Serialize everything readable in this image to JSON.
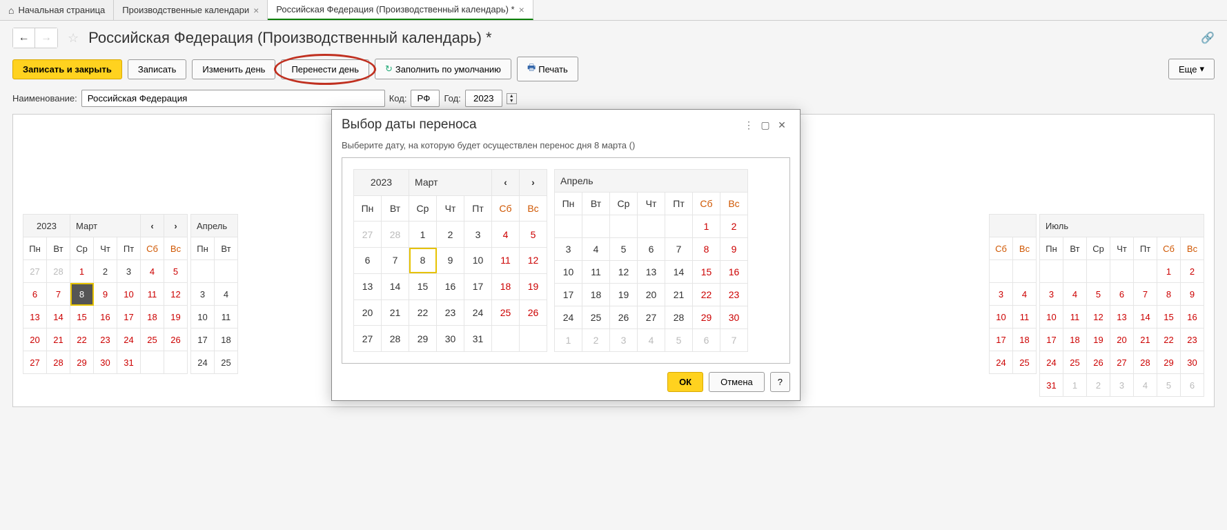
{
  "tabs": {
    "home": "Начальная страница",
    "cal_list": "Производственные календари",
    "current": "Российская Федерация (Производственный календарь) *"
  },
  "page_title": "Российская Федерация (Производственный календарь) *",
  "toolbar": {
    "save_close": "Записать и закрыть",
    "save": "Записать",
    "change_day": "Изменить день",
    "move_day": "Перенести день",
    "fill_default": "Заполнить по умолчанию",
    "print": "Печать",
    "more": "Еще"
  },
  "form": {
    "name_label": "Наименование:",
    "name_value": "Российская Федерация",
    "code_label": "Код:",
    "code_value": "РФ",
    "year_label": "Год:",
    "year_value": "2023"
  },
  "dialog": {
    "title": "Выбор даты переноса",
    "subtitle": "Выберите дату, на которую будет осуществлен перенос дня 8 марта ()",
    "ok": "ОК",
    "cancel": "Отмена",
    "help": "?"
  },
  "dow": [
    "Пн",
    "Вт",
    "Ср",
    "Чт",
    "Пт",
    "Сб",
    "Вс"
  ],
  "bg_months": {
    "year": "2023",
    "march": "Март",
    "april": "Апрель",
    "july": "Июль"
  },
  "dlg_months": {
    "year": "2023",
    "march": "Март",
    "april": "Апрель"
  },
  "bg_march": [
    [
      {
        "d": "27",
        "c": "other"
      },
      {
        "d": "28",
        "c": "other"
      },
      {
        "d": "1",
        "c": "wk"
      },
      {
        "d": "2",
        "c": ""
      },
      {
        "d": "3",
        "c": ""
      },
      {
        "d": "4",
        "c": "wk"
      },
      {
        "d": "5",
        "c": "wk"
      }
    ],
    [
      {
        "d": "6",
        "c": "wk"
      },
      {
        "d": "7",
        "c": "wk"
      },
      {
        "d": "8",
        "c": "sel"
      },
      {
        "d": "9",
        "c": "wk"
      },
      {
        "d": "10",
        "c": "wk"
      },
      {
        "d": "11",
        "c": "wk"
      },
      {
        "d": "12",
        "c": "wk"
      }
    ],
    [
      {
        "d": "13",
        "c": "wk"
      },
      {
        "d": "14",
        "c": "wk"
      },
      {
        "d": "15",
        "c": "wk"
      },
      {
        "d": "16",
        "c": "wk"
      },
      {
        "d": "17",
        "c": "wk"
      },
      {
        "d": "18",
        "c": "wk"
      },
      {
        "d": "19",
        "c": "wk"
      }
    ],
    [
      {
        "d": "20",
        "c": "wk"
      },
      {
        "d": "21",
        "c": "wk"
      },
      {
        "d": "22",
        "c": "wk"
      },
      {
        "d": "23",
        "c": "wk"
      },
      {
        "d": "24",
        "c": "wk"
      },
      {
        "d": "25",
        "c": "wk"
      },
      {
        "d": "26",
        "c": "wk"
      }
    ],
    [
      {
        "d": "27",
        "c": "wk"
      },
      {
        "d": "28",
        "c": "wk"
      },
      {
        "d": "29",
        "c": "wk"
      },
      {
        "d": "30",
        "c": "wk"
      },
      {
        "d": "31",
        "c": "wk"
      },
      {
        "d": "",
        "c": ""
      },
      {
        "d": "",
        "c": ""
      }
    ]
  ],
  "bg_april_partial": [
    [
      {
        "d": "",
        "c": ""
      },
      {
        "d": "",
        "c": ""
      }
    ],
    [
      {
        "d": "3",
        "c": ""
      },
      {
        "d": "4",
        "c": ""
      }
    ],
    [
      {
        "d": "10",
        "c": ""
      },
      {
        "d": "11",
        "c": ""
      }
    ],
    [
      {
        "d": "17",
        "c": ""
      },
      {
        "d": "18",
        "c": ""
      }
    ],
    [
      {
        "d": "24",
        "c": ""
      },
      {
        "d": "25",
        "c": ""
      }
    ]
  ],
  "bg_right_sbvs": [
    [
      {
        "d": "",
        "c": ""
      },
      {
        "d": "",
        "c": ""
      }
    ],
    [
      {
        "d": "3",
        "c": "wk"
      },
      {
        "d": "4",
        "c": "wk"
      }
    ],
    [
      {
        "d": "10",
        "c": "wk"
      },
      {
        "d": "11",
        "c": "wk"
      }
    ],
    [
      {
        "d": "17",
        "c": "wk"
      },
      {
        "d": "18",
        "c": "wk"
      }
    ],
    [
      {
        "d": "24",
        "c": "wk"
      },
      {
        "d": "25",
        "c": "wk"
      }
    ]
  ],
  "bg_july": [
    [
      {
        "d": "",
        "c": ""
      },
      {
        "d": "",
        "c": ""
      },
      {
        "d": "",
        "c": ""
      },
      {
        "d": "",
        "c": ""
      },
      {
        "d": "",
        "c": ""
      },
      {
        "d": "1",
        "c": "wk"
      },
      {
        "d": "2",
        "c": "wk"
      }
    ],
    [
      {
        "d": "3",
        "c": "wk"
      },
      {
        "d": "4",
        "c": "wk"
      },
      {
        "d": "5",
        "c": "wk"
      },
      {
        "d": "6",
        "c": "wk"
      },
      {
        "d": "7",
        "c": "wk"
      },
      {
        "d": "8",
        "c": "wk"
      },
      {
        "d": "9",
        "c": "wk"
      }
    ],
    [
      {
        "d": "10",
        "c": "wk"
      },
      {
        "d": "11",
        "c": "wk"
      },
      {
        "d": "12",
        "c": "wk"
      },
      {
        "d": "13",
        "c": "wk"
      },
      {
        "d": "14",
        "c": "wk"
      },
      {
        "d": "15",
        "c": "wk"
      },
      {
        "d": "16",
        "c": "wk"
      }
    ],
    [
      {
        "d": "17",
        "c": "wk"
      },
      {
        "d": "18",
        "c": "wk"
      },
      {
        "d": "19",
        "c": "wk"
      },
      {
        "d": "20",
        "c": "wk"
      },
      {
        "d": "21",
        "c": "wk"
      },
      {
        "d": "22",
        "c": "wk"
      },
      {
        "d": "23",
        "c": "wk"
      }
    ],
    [
      {
        "d": "24",
        "c": "wk"
      },
      {
        "d": "25",
        "c": "wk"
      },
      {
        "d": "26",
        "c": "wk"
      },
      {
        "d": "27",
        "c": "wk"
      },
      {
        "d": "28",
        "c": "wk"
      },
      {
        "d": "29",
        "c": "wk"
      },
      {
        "d": "30",
        "c": "wk"
      }
    ],
    [
      {
        "d": "31",
        "c": "wk"
      },
      {
        "d": "1",
        "c": "other"
      },
      {
        "d": "2",
        "c": "other"
      },
      {
        "d": "3",
        "c": "other"
      },
      {
        "d": "4",
        "c": "other"
      },
      {
        "d": "5",
        "c": "other"
      },
      {
        "d": "6",
        "c": "other"
      }
    ]
  ],
  "dlg_march": [
    [
      {
        "d": "27",
        "c": "other"
      },
      {
        "d": "28",
        "c": "other"
      },
      {
        "d": "1",
        "c": ""
      },
      {
        "d": "2",
        "c": ""
      },
      {
        "d": "3",
        "c": ""
      },
      {
        "d": "4",
        "c": "wk"
      },
      {
        "d": "5",
        "c": "wk"
      }
    ],
    [
      {
        "d": "6",
        "c": ""
      },
      {
        "d": "7",
        "c": ""
      },
      {
        "d": "8",
        "c": "hl"
      },
      {
        "d": "9",
        "c": ""
      },
      {
        "d": "10",
        "c": ""
      },
      {
        "d": "11",
        "c": "wk"
      },
      {
        "d": "12",
        "c": "wk"
      }
    ],
    [
      {
        "d": "13",
        "c": ""
      },
      {
        "d": "14",
        "c": ""
      },
      {
        "d": "15",
        "c": ""
      },
      {
        "d": "16",
        "c": ""
      },
      {
        "d": "17",
        "c": ""
      },
      {
        "d": "18",
        "c": "wk"
      },
      {
        "d": "19",
        "c": "wk"
      }
    ],
    [
      {
        "d": "20",
        "c": ""
      },
      {
        "d": "21",
        "c": ""
      },
      {
        "d": "22",
        "c": ""
      },
      {
        "d": "23",
        "c": ""
      },
      {
        "d": "24",
        "c": ""
      },
      {
        "d": "25",
        "c": "wk"
      },
      {
        "d": "26",
        "c": "wk"
      }
    ],
    [
      {
        "d": "27",
        "c": ""
      },
      {
        "d": "28",
        "c": ""
      },
      {
        "d": "29",
        "c": ""
      },
      {
        "d": "30",
        "c": ""
      },
      {
        "d": "31",
        "c": ""
      },
      {
        "d": "",
        "c": ""
      },
      {
        "d": "",
        "c": ""
      }
    ]
  ],
  "dlg_april": [
    [
      {
        "d": "",
        "c": ""
      },
      {
        "d": "",
        "c": ""
      },
      {
        "d": "",
        "c": ""
      },
      {
        "d": "",
        "c": ""
      },
      {
        "d": "",
        "c": ""
      },
      {
        "d": "1",
        "c": "wk"
      },
      {
        "d": "2",
        "c": "wk"
      }
    ],
    [
      {
        "d": "3",
        "c": ""
      },
      {
        "d": "4",
        "c": ""
      },
      {
        "d": "5",
        "c": ""
      },
      {
        "d": "6",
        "c": ""
      },
      {
        "d": "7",
        "c": ""
      },
      {
        "d": "8",
        "c": "wk"
      },
      {
        "d": "9",
        "c": "wk"
      }
    ],
    [
      {
        "d": "10",
        "c": ""
      },
      {
        "d": "11",
        "c": ""
      },
      {
        "d": "12",
        "c": ""
      },
      {
        "d": "13",
        "c": ""
      },
      {
        "d": "14",
        "c": ""
      },
      {
        "d": "15",
        "c": "wk"
      },
      {
        "d": "16",
        "c": "wk"
      }
    ],
    [
      {
        "d": "17",
        "c": ""
      },
      {
        "d": "18",
        "c": ""
      },
      {
        "d": "19",
        "c": ""
      },
      {
        "d": "20",
        "c": ""
      },
      {
        "d": "21",
        "c": ""
      },
      {
        "d": "22",
        "c": "wk"
      },
      {
        "d": "23",
        "c": "wk"
      }
    ],
    [
      {
        "d": "24",
        "c": ""
      },
      {
        "d": "25",
        "c": ""
      },
      {
        "d": "26",
        "c": ""
      },
      {
        "d": "27",
        "c": ""
      },
      {
        "d": "28",
        "c": ""
      },
      {
        "d": "29",
        "c": "wk"
      },
      {
        "d": "30",
        "c": "wk"
      }
    ],
    [
      {
        "d": "1",
        "c": "other"
      },
      {
        "d": "2",
        "c": "other"
      },
      {
        "d": "3",
        "c": "other"
      },
      {
        "d": "4",
        "c": "other"
      },
      {
        "d": "5",
        "c": "other"
      },
      {
        "d": "6",
        "c": "other"
      },
      {
        "d": "7",
        "c": "other"
      }
    ]
  ]
}
